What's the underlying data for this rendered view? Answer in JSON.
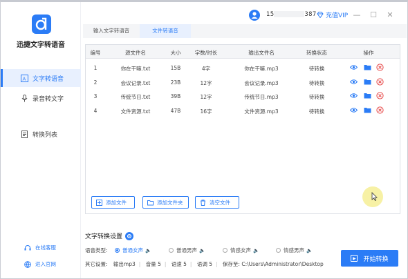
{
  "app": {
    "name": "迅捷文字转语音"
  },
  "sidebar": {
    "items": [
      {
        "label": "文字转语音",
        "icon": "text-to-speech-icon",
        "active": true
      },
      {
        "label": "录音转文字",
        "icon": "microphone-icon",
        "active": false
      },
      {
        "label": "转换列表",
        "icon": "list-icon",
        "active": false
      }
    ],
    "links": [
      {
        "label": "在线客服",
        "icon": "customer-service-icon"
      },
      {
        "label": "进入官网",
        "icon": "globe-icon"
      }
    ]
  },
  "header": {
    "phone_prefix": "15",
    "phone_suffix": "387",
    "vip_label": "充值VIP",
    "minimize": "—",
    "maximize": "☐",
    "close": "✕"
  },
  "tabs": [
    {
      "label": "输入文字转语音",
      "active": false
    },
    {
      "label": "文件转语音",
      "active": true
    }
  ],
  "table": {
    "columns": [
      "编号",
      "源文件名",
      "大小",
      "字数/时长",
      "输出文件名",
      "转换状态",
      "操作"
    ],
    "rows": [
      {
        "no": "1",
        "source": "你在干嘛.txt",
        "size": "15B",
        "count": "4字",
        "output": "你在干嘛.mp3",
        "status": "待转换"
      },
      {
        "no": "2",
        "source": "会议记录.txt",
        "size": "23B",
        "count": "12字",
        "output": "会议记录.mp3",
        "status": "待转换"
      },
      {
        "no": "3",
        "source": "传统节日.txt",
        "size": "39B",
        "count": "12字",
        "output": "传统节日.mp3",
        "status": "待转换"
      },
      {
        "no": "4",
        "source": "文件资源.txt",
        "size": "47B",
        "count": "16字",
        "output": "文件资源.mp3",
        "status": "待转换"
      }
    ]
  },
  "actions": {
    "add_file": "添加文件",
    "add_folder": "添加文件夹",
    "clear_files": "清空文件"
  },
  "settings": {
    "title": "文字转换设置",
    "voice_type_label": "语音类型:",
    "voice_options": [
      {
        "label": "普通女声",
        "selected": true
      },
      {
        "label": "普通男声",
        "selected": false
      },
      {
        "label": "情感女声",
        "selected": false
      },
      {
        "label": "情感男声",
        "selected": false
      }
    ],
    "other_label": "其它设置:",
    "output_format": "输出mp3",
    "volume": "音量 5",
    "speed": "语速 5",
    "pitch": "语调 5",
    "save_to": "保存至: C:\\Users\\Administrator\\Desktop",
    "start_button": "开始转换"
  },
  "colors": {
    "accent": "#2b7cf6",
    "danger": "#e64545"
  }
}
